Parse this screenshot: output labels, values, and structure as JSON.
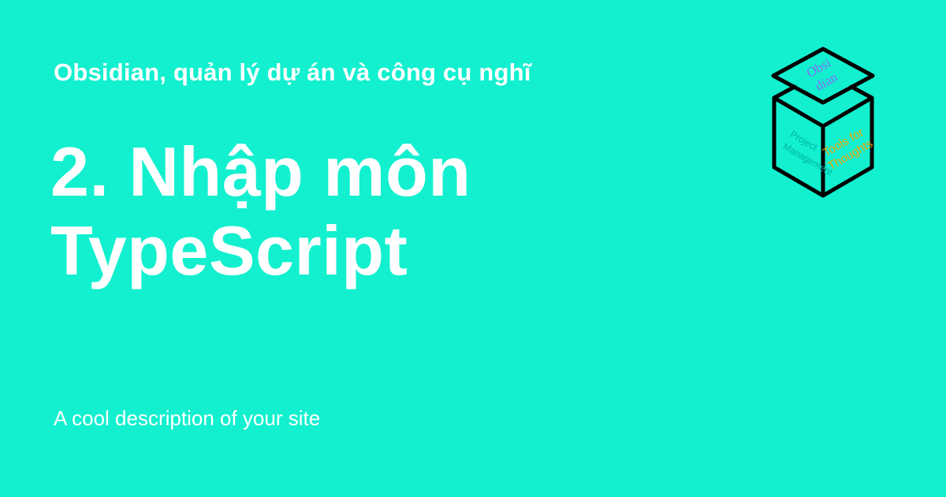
{
  "card": {
    "site_name": "Obsidian, quản lý dự án và công cụ nghĩ",
    "title": "2. Nhập môn TypeScript",
    "description": "A cool description of your site",
    "background_color": "#12f0cf",
    "text_color": "#ffffff"
  },
  "logo": {
    "icon": "cube-logo-icon",
    "top_text_line1": "Obsi",
    "top_text_line2": "dian",
    "left_text_line1": "Project",
    "left_text_line2": "Management",
    "right_text_line1": "Tools for",
    "right_text_line2": "Thoughts",
    "colors": {
      "outline": "#000000",
      "top_text": "#7f6df2",
      "left_text": "#00b3a6",
      "right_text": "#f0a500"
    }
  }
}
